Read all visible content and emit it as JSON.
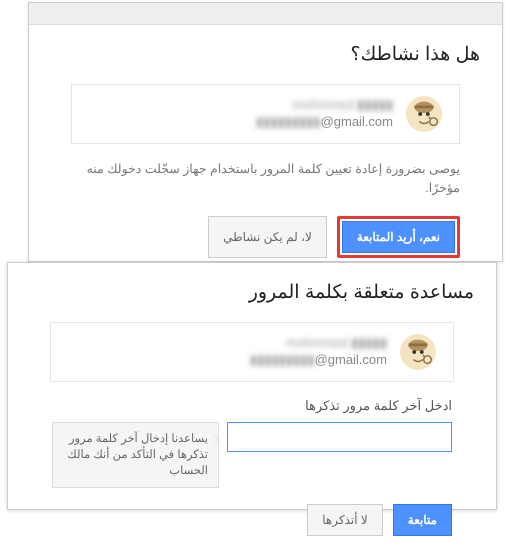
{
  "panel1": {
    "title": "هل هذا نشاطك؟",
    "account": {
      "name_blur": "mohmmed ▮▮▮▮▮",
      "email_blur": "▮▮▮▮▮▮▮▮▮",
      "email_domain": "@gmail.com"
    },
    "description": "يوصى بضرورة إعادة تعيين كلمة المرور باستخدام جهاز سجّلت دخولك منه مؤخرًا.",
    "yes_button": "نعم، أريد المتابعة",
    "no_button": "لا، لم يكن نشاطي"
  },
  "panel2": {
    "title": "مساعدة متعلقة بكلمة المرور",
    "account": {
      "name_blur": "mohmmed ▮▮▮▮▮",
      "email_blur": "▮▮▮▮▮▮▮▮▮",
      "email_domain": "@gmail.com"
    },
    "input_label": "ادخل آخر كلمة مرور تذكرها",
    "input_value": "",
    "tooltip": "يساعدنا إدخال آخر كلمة مرور تذكرها في التأكد من أنك مالك الحساب",
    "continue_button": "متابعة",
    "dont_remember_button": "لا أتذكرها"
  }
}
